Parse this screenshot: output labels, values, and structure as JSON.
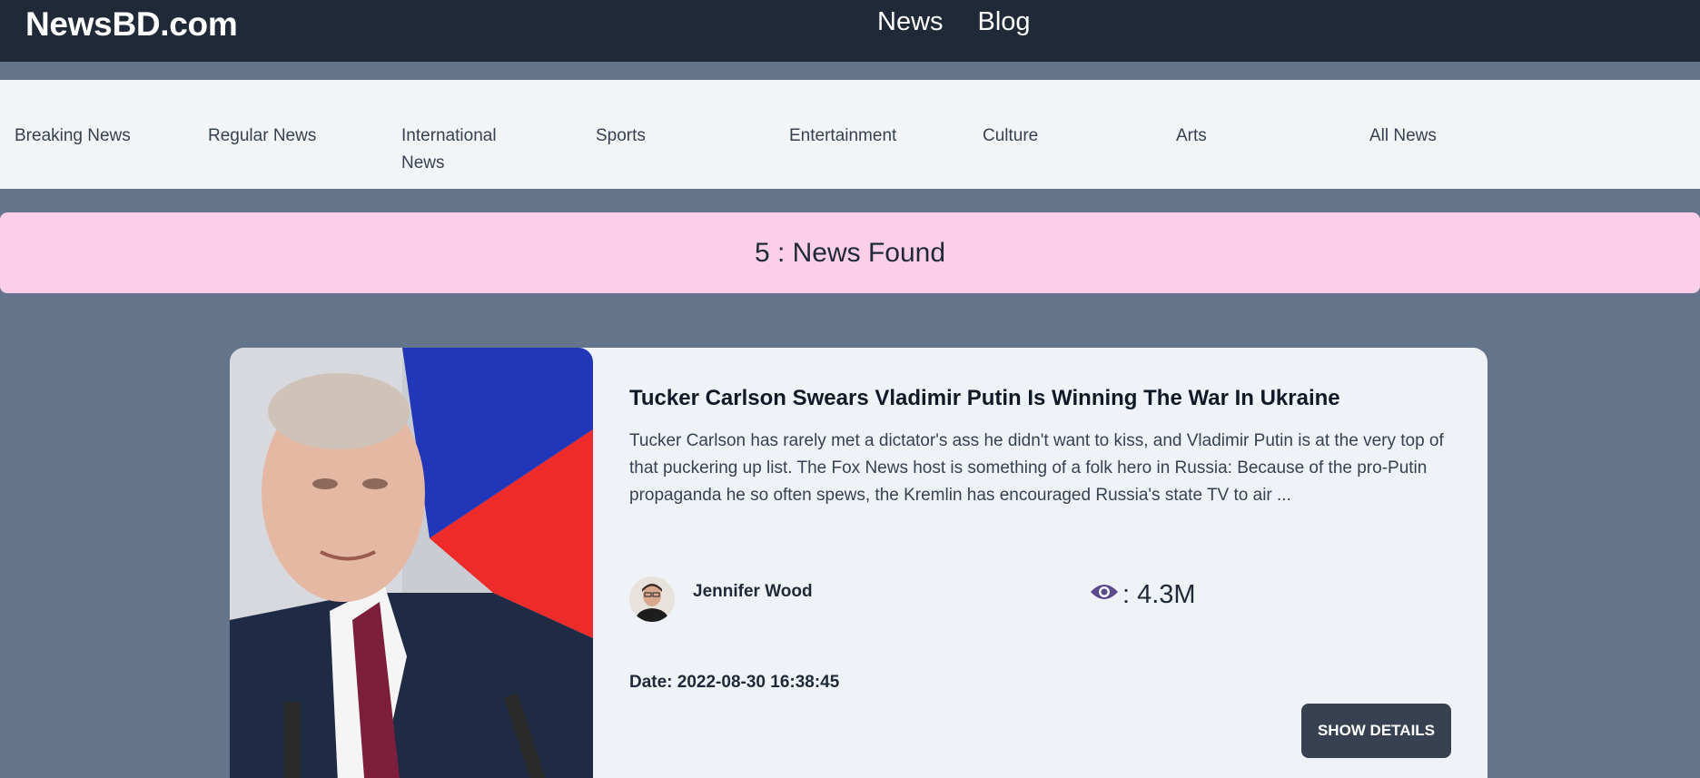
{
  "header": {
    "brand": "NewsBD.com",
    "nav": [
      "News",
      "Blog"
    ]
  },
  "categories": [
    "Breaking News",
    "Regular News",
    "International News",
    "Sports",
    "Entertainment",
    "Culture",
    "Arts",
    "All News"
  ],
  "result_banner": "5 : News Found",
  "news": {
    "title": "Tucker Carlson Swears Vladimir Putin Is Winning The War In Ukraine",
    "description": "Tucker Carlson has rarely met a dictator's ass he didn't want to kiss, and Vladimir Putin is at the very top of that puckering up list. The Fox News host is something of a folk hero in Russia: Because of the pro-Putin propaganda he so often spews, the Kremlin has encouraged Russia's state TV to air ...",
    "author": "Jennifer Wood",
    "views": ": 4.3M",
    "date": "Date: 2022-08-30 16:38:45",
    "button": "SHOW DETAILS",
    "view_icon_color": "#5b4b8a"
  },
  "colors": {
    "header_bg": "#1f2937",
    "page_bg": "#64748b",
    "banner_bg": "#fbcfe8",
    "card_bg": "#eff3f8",
    "button_bg": "#374151"
  }
}
